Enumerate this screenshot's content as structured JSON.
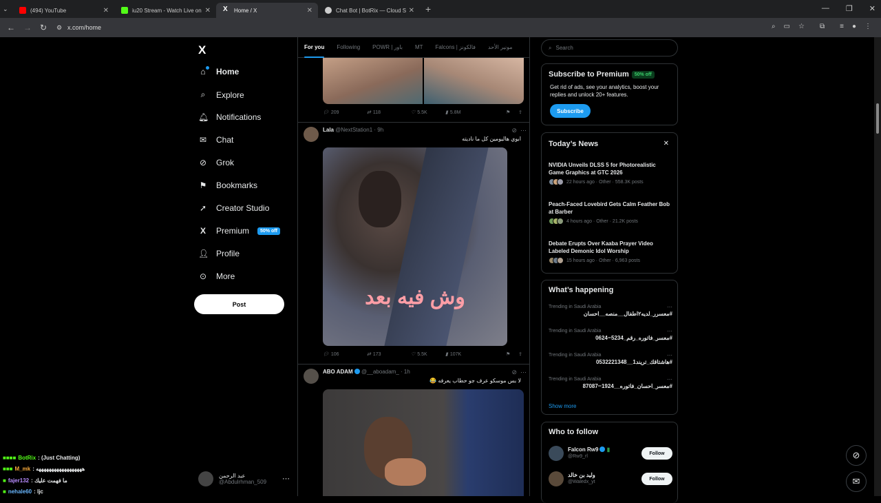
{
  "browser": {
    "tabs": [
      {
        "title": "(494) YouTube",
        "color": "#ff0000"
      },
      {
        "title": "iu20 Stream - Watch Live on Ki",
        "color": "#53fc18"
      },
      {
        "title": "Home / X",
        "color": "#ffffff"
      },
      {
        "title": "Chat Bot | BotRix — Cloud Strea",
        "color": "#cccccc"
      }
    ],
    "url": "x.com/home"
  },
  "leftnav": {
    "logo": "X",
    "items": [
      {
        "label": "Home",
        "icon": "home-icon"
      },
      {
        "label": "Explore",
        "icon": "search-icon"
      },
      {
        "label": "Notifications",
        "icon": "bell-icon"
      },
      {
        "label": "Chat",
        "icon": "mail-icon"
      },
      {
        "label": "Grok",
        "icon": "grok-icon"
      },
      {
        "label": "Bookmarks",
        "icon": "bookmark-icon"
      },
      {
        "label": "Creator Studio",
        "icon": "rocket-icon"
      },
      {
        "label": "Premium",
        "icon": "x-icon"
      },
      {
        "label": "Profile",
        "icon": "person-icon"
      },
      {
        "label": "More",
        "icon": "more-icon"
      }
    ],
    "premium_badge": "50% off",
    "post_label": "Post",
    "account": {
      "name": "عبد الرحمن",
      "handle": "@Abdulrhman_509"
    }
  },
  "chat_overlay": [
    {
      "user": "BotRix",
      "text": ": (Just Chatting)",
      "color": "#53fc18"
    },
    {
      "user": "M_mk",
      "text": ": ههههههههههههههههههه",
      "color": "#f6a93b"
    },
    {
      "user": "fajer132",
      "text": ": ما فهمت عليك",
      "color": "#b88cff"
    },
    {
      "user": "nehale60",
      "text": ": ljc",
      "color": "#6ab7ff"
    }
  ],
  "feed": {
    "tabs": [
      "For you",
      "Following",
      "POWR | باور",
      "MT",
      "Falcons | فالكونز",
      "مونير الأحد"
    ],
    "stats_top": {
      "replies": "209",
      "reposts": "118",
      "likes": "5.5K",
      "views": "5.8M"
    },
    "tweet1": {
      "name": "Lala",
      "handle": "@NextStation1",
      "time": "· 9h",
      "text": "ابوي هاليومين كل ما ناديته",
      "overlay_text": "وش فيه بعد",
      "stats": {
        "replies": "106",
        "reposts": "173",
        "likes": "5.5K",
        "views": "107K"
      }
    },
    "tweet2": {
      "name": "ABO ADAM",
      "handle": "@__aboadam_",
      "time": "· 1h",
      "text": "لا بس موسكو عرف جو حطاب يعرفه 😂"
    }
  },
  "right": {
    "search_placeholder": "Search",
    "premium": {
      "title": "Subscribe to Premium",
      "badge": "50% off",
      "text": "Get rid of ads, see your analytics, boost your replies and unlock 20+ features.",
      "button": "Subscribe"
    },
    "news": {
      "title": "Today’s News",
      "items": [
        {
          "title": "NVIDIA Unveils DLSS 5 for Photorealistic Game Graphics at GTC 2026",
          "meta": "22 hours ago · Other · 558.3K posts"
        },
        {
          "title": "Peach-Faced Lovebird Gets Calm Feather Bob at Barber",
          "meta": "4 hours ago · Other · 21.2K posts"
        },
        {
          "title": "Debate Erupts Over Kaaba Prayer Video Labeled Demonic Idol Worship",
          "meta": "15 hours ago · Other · 6,963 posts"
        }
      ]
    },
    "happening": {
      "title": "What’s happening",
      "items": [
        {
          "sub": "Trending in Saudi Arabia",
          "name": "#معسرر_لديه٢اطفال__منصه__احسان"
        },
        {
          "sub": "Trending in Saudi Arabia",
          "name": "#معسر_فاتوره_رقم_0624ⵈ5234"
        },
        {
          "sub": "Trending in Saudi Arabia",
          "name": "#هاشتاقك_تريند1__0532221348"
        },
        {
          "sub": "Trending in Saudi Arabia",
          "name": "#معسر_احسان_فاتوره__87087ⵈ1924"
        }
      ],
      "show_more": "Show more"
    },
    "follow": {
      "title": "Who to follow",
      "items": [
        {
          "name": "Falcon Rw9",
          "handle": "@Rw9_rl",
          "button": "Follow"
        },
        {
          "name": "وليد بن خالد",
          "handle": "@Waledx_yt",
          "button": "Follow"
        }
      ]
    }
  }
}
